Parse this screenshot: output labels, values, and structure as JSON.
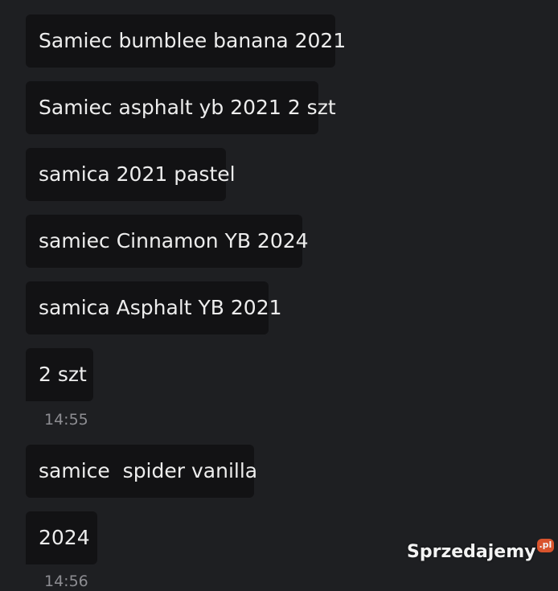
{
  "messages": [
    {
      "text": "Samiec bumblee banana 2021"
    },
    {
      "text": "Samiec asphalt yb 2021 2 szt"
    },
    {
      "text": "samica 2021 pastel"
    },
    {
      "text": "samiec Cinnamon YB 2024"
    },
    {
      "text": "samica Asphalt YB 2021"
    },
    {
      "text": "2 szt"
    },
    {
      "text": "samice  spider vanilla"
    },
    {
      "text": "2024"
    }
  ],
  "timestamps": [
    "14:55",
    "14:56"
  ],
  "watermark": {
    "text": "Sprzedajemy",
    "badge": ".pl",
    "badge_color": "#e4572e"
  },
  "colors": {
    "background": "#1e1f22",
    "bubble": "#121214",
    "text": "#ededed",
    "timestamp": "#8d8d92"
  }
}
